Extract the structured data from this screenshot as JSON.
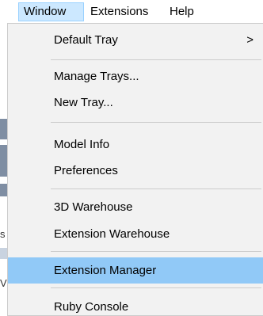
{
  "menubar": {
    "items": [
      {
        "label": "Window",
        "active": true
      },
      {
        "label": "Extensions",
        "active": false
      },
      {
        "label": "Help",
        "active": false
      }
    ]
  },
  "window_menu": {
    "items": [
      {
        "label": "Default Tray",
        "submenu_arrow": ">"
      },
      {
        "label": "Manage Trays..."
      },
      {
        "label": "New Tray..."
      },
      {
        "label": "Model Info"
      },
      {
        "label": "Preferences"
      },
      {
        "label": "3D Warehouse"
      },
      {
        "label": "Extension Warehouse"
      },
      {
        "label": "Extension Manager",
        "highlighted": true
      },
      {
        "label": "Ruby Console"
      }
    ]
  },
  "background_fragments": {
    "glyph_a": "s",
    "glyph_b": "V"
  },
  "colors": {
    "active_menubar_bg": "#cce8ff",
    "highlight_bg": "#91c9f7",
    "menu_bg": "#f2f2f2"
  }
}
